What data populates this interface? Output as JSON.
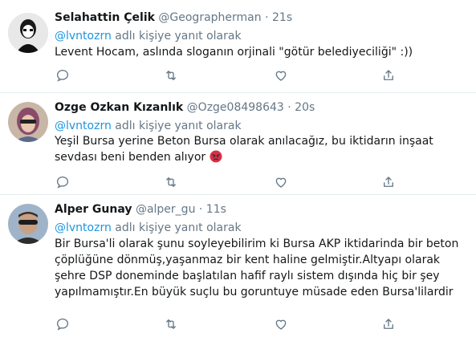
{
  "tweets": [
    {
      "name": "Selahattin Çelik",
      "handle": "@Geographerman",
      "separator": "·",
      "time": "21s",
      "reply_prefix": "@lvntozrn",
      "reply_suffix": " adlı kişiye yanıt olarak",
      "text": "Levent Hocam, aslında sloganın orjinali  \"götür belediyeciliği\" :))",
      "avatar": "avatar-selahattin"
    },
    {
      "name": "Ozge Ozkan Kızanlık",
      "handle": "@Ozge08498643",
      "separator": "·",
      "time": "20s",
      "reply_prefix": "@lvntozrn",
      "reply_suffix": " adlı kişiye yanıt olarak",
      "text": "Yeşil Bursa yerine Beton Bursa olarak anılacağız, bu iktidarın inşaat sevdası beni benden alıyor",
      "emoji": "angry-face",
      "avatar": "avatar-ozge"
    },
    {
      "name": "Alper Gunay",
      "handle": "@alper_gu",
      "separator": "·",
      "time": "11s",
      "reply_prefix": "@lvntozrn",
      "reply_suffix": " adlı kişiye yanıt olarak",
      "text": "Bir Bursa'li olarak şunu soyleyebilirim ki Bursa AKP iktidarinda bir beton çöplüğüne dönmüş,yaşanmaz bir kent haline gelmiştir.Altyapı olarak şehre DSP doneminde başlatılan hafif raylı sistem dışında hiç bir şey yapılmamıştır.En büyük suçlu bu goruntuye müsade eden Bursa'lilardir",
      "avatar": "avatar-alper"
    }
  ],
  "icons": [
    "reply-icon",
    "retweet-icon",
    "like-icon",
    "share-icon"
  ],
  "colors": {
    "link": "#1b95e0",
    "secondary": "#657786",
    "divider": "#e6ecf0",
    "icon": "#657786"
  }
}
